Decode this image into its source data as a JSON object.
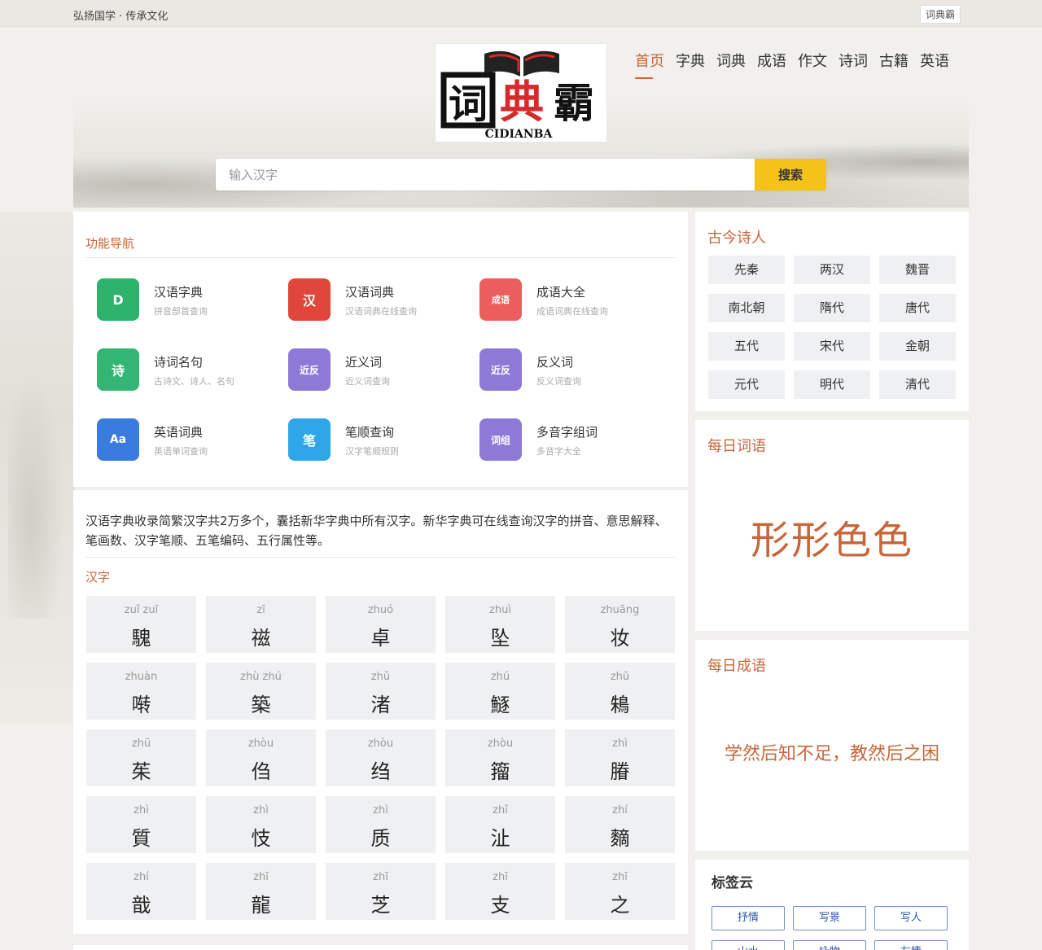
{
  "topbar": {
    "slogan": "弘扬国学 · 传承文化",
    "site_link": "词典霸"
  },
  "logo": {
    "text": "CIDIANBA",
    "chars": [
      "词",
      "典",
      "霸"
    ]
  },
  "nav": [
    "首页",
    "字典",
    "词典",
    "成语",
    "作文",
    "诗词",
    "古籍",
    "英语"
  ],
  "search": {
    "placeholder": "输入汉字",
    "button": "搜索"
  },
  "features": {
    "title": "功能导航",
    "items": [
      {
        "name": "汉语字典",
        "desc": "拼音部首查询",
        "icon": "D",
        "color": "#2db36b"
      },
      {
        "name": "汉语词典",
        "desc": "汉语词典在线查询",
        "icon": "汉",
        "color": "#e0463a"
      },
      {
        "name": "成语大全",
        "desc": "成语词典在线查询",
        "icon": "成语",
        "color": "#ec5d5d"
      },
      {
        "name": "诗词名句",
        "desc": "古诗文、诗人、名句",
        "icon": "诗",
        "color": "#33b673"
      },
      {
        "name": "近义词",
        "desc": "近义词查询",
        "icon": "近反",
        "color": "#8e7ad6"
      },
      {
        "name": "反义词",
        "desc": "反义词查询",
        "icon": "近反",
        "color": "#8e7ad6"
      },
      {
        "name": "英语词典",
        "desc": "英语单词查询",
        "icon": "Aa",
        "color": "#3a7be0"
      },
      {
        "name": "笔顺查询",
        "desc": "汉字笔顺规则",
        "icon": "笔",
        "color": "#2ea6e8"
      },
      {
        "name": "多音字组词",
        "desc": "多音字大全",
        "icon": "词组",
        "color": "#8e7ad6"
      }
    ]
  },
  "hanzi": {
    "intro": "汉语字典收录简繁汉字共2万多个，囊括新华字典中所有汉字。新华字典可在线查询汉字的拼音、意思解释、笔画数、汉字笔顺、五笔编码、五行属性等。",
    "title": "汉字",
    "cells": [
      {
        "py": "zuǐ zuī",
        "ch": "騩"
      },
      {
        "py": "zī",
        "ch": "禌"
      },
      {
        "py": "zhuó",
        "ch": "卓"
      },
      {
        "py": "zhuì",
        "ch": "坠"
      },
      {
        "py": "zhuāng",
        "ch": "妆"
      },
      {
        "py": "zhuàn",
        "ch": "啭"
      },
      {
        "py": "zhù zhú",
        "ch": "築"
      },
      {
        "py": "zhǔ",
        "ch": "渚"
      },
      {
        "py": "zhú",
        "ch": "鱁"
      },
      {
        "py": "zhū",
        "ch": "鴸"
      },
      {
        "py": "zhū",
        "ch": "茱"
      },
      {
        "py": "zhòu",
        "ch": "㑇"
      },
      {
        "py": "zhòu",
        "ch": "绉"
      },
      {
        "py": "zhòu",
        "ch": "籀"
      },
      {
        "py": "zhì",
        "ch": "膡"
      },
      {
        "py": "zhì",
        "ch": "質"
      },
      {
        "py": "zhì",
        "ch": "忮"
      },
      {
        "py": "zhì",
        "ch": "质"
      },
      {
        "py": "zhǐ",
        "ch": "沚"
      },
      {
        "py": "zhí",
        "ch": "䵂"
      },
      {
        "py": "zhí",
        "ch": "戠"
      },
      {
        "py": "zhī",
        "ch": "龍"
      },
      {
        "py": "zhī",
        "ch": "芝"
      },
      {
        "py": "zhī",
        "ch": "支"
      },
      {
        "py": "zhī",
        "ch": "之"
      }
    ]
  },
  "poets": {
    "title": "古今诗人",
    "eras": [
      "先秦",
      "两汉",
      "魏晋",
      "南北朝",
      "隋代",
      "唐代",
      "五代",
      "宋代",
      "金朝",
      "元代",
      "明代",
      "清代"
    ]
  },
  "daily_word": {
    "title": "每日词语",
    "word": "形形色色"
  },
  "daily_idiom": {
    "title": "每日成语",
    "text": "学然后知不足，教然后之困"
  },
  "tag_cloud": {
    "title": "标签云",
    "tags": [
      "抒情",
      "写景",
      "写人",
      "山水",
      "咏物",
      "友情"
    ]
  },
  "colors": {
    "accent": "#c7663a",
    "search_button": "#f5c219",
    "tag_border": "#6f8fc8"
  }
}
